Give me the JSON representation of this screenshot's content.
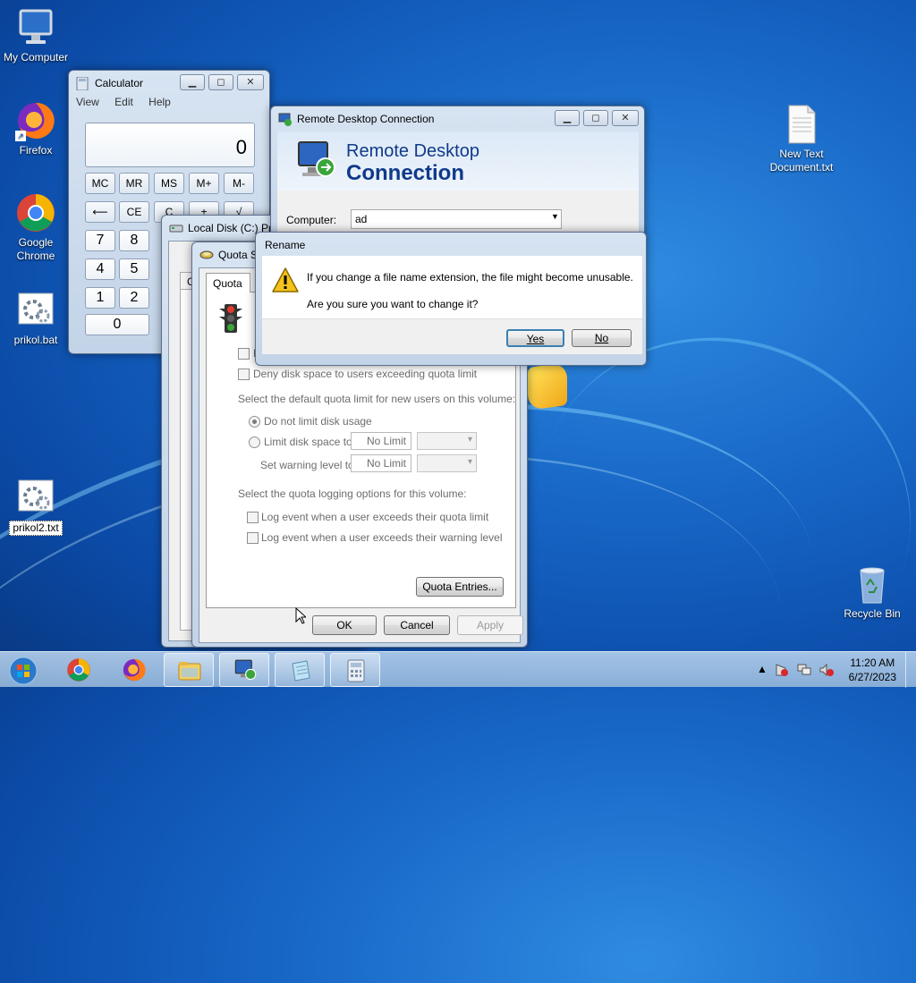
{
  "desktop": {
    "icons": [
      {
        "label": "My Computer"
      },
      {
        "label": "Firefox"
      },
      {
        "label": "Google Chrome"
      },
      {
        "label": "prikol.bat"
      },
      {
        "label": "prikol2.txt"
      },
      {
        "label": "New Text Document.txt"
      },
      {
        "label": "Recycle Bin"
      }
    ]
  },
  "calculator": {
    "title": "Calculator",
    "menu": [
      "View",
      "Edit",
      "Help"
    ],
    "display": "0",
    "memory_keys": [
      "MC",
      "MR",
      "MS",
      "M+",
      "M-"
    ],
    "row2": [
      "⟵",
      "CE",
      "C",
      "±",
      "√"
    ],
    "digits": [
      "7",
      "8",
      "4",
      "5",
      "1",
      "2",
      "0"
    ]
  },
  "local_disk": {
    "title": "Local Disk (C:) Pr",
    "tab": "Ge"
  },
  "quota": {
    "title": "Quota S",
    "tab": "Quota",
    "enable_label": "E",
    "deny_label": "Deny disk space to users exceeding quota limit",
    "default_limit_label": "Select the default quota limit for new users on this volume:",
    "no_limit_radio": "Do not limit disk usage",
    "limit_radio": "Limit disk space to",
    "warning_label": "Set warning level to",
    "limit_value": "No Limit",
    "warning_value": "No Limit",
    "logging_label": "Select the quota logging options for this volume:",
    "log_quota": "Log event when a user exceeds their quota limit",
    "log_warning": "Log event when a user exceeds their warning level",
    "entries_button": "Quota Entries...",
    "ok": "OK",
    "cancel": "Cancel",
    "apply": "Apply"
  },
  "rdc": {
    "title": "Remote Desktop Connection",
    "banner_line1": "Remote Desktop",
    "banner_line2": "Connection",
    "computer_label": "Computer:",
    "computer_value": "ad"
  },
  "rename": {
    "title": "Rename",
    "message1": "If you change a file name extension, the file might become unusable.",
    "message2": "Are you sure you want to change it?",
    "yes": "Yes",
    "no": "No"
  },
  "taskbar": {
    "time": "11:20 AM",
    "date": "6/27/2023"
  },
  "colors": {
    "accent": "#0f3a8a",
    "desktop": "#1766c6"
  }
}
